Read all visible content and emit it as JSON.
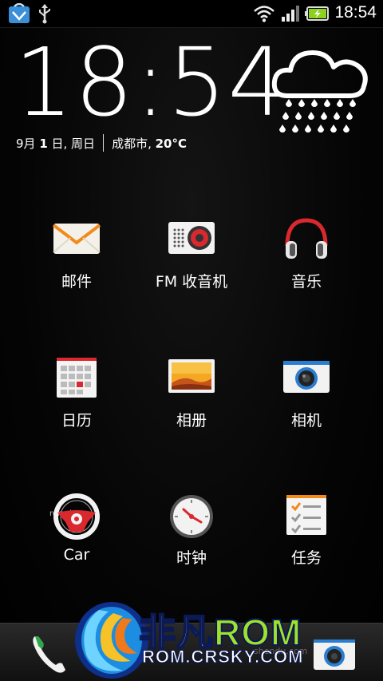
{
  "status_bar": {
    "left_icons": [
      "store-bag-icon",
      "usb-icon"
    ],
    "right_icons": [
      "wifi-icon",
      "signal-icon",
      "battery-charging-icon"
    ],
    "time": "18:54"
  },
  "clock_widget": {
    "time": "18:54",
    "date_prefix": "9月 ",
    "date_day": "1",
    "date_suffix": " 日, 周日",
    "city": "成都市, ",
    "temperature": "20°C",
    "weather_icon": "cloud-rain-icon"
  },
  "apps": [
    {
      "label": "邮件",
      "icon": "mail-icon"
    },
    {
      "label": "FM 收音机",
      "icon": "fm-radio-icon"
    },
    {
      "label": "音乐",
      "icon": "headphones-icon"
    },
    {
      "label": "日历",
      "icon": "calendar-icon"
    },
    {
      "label": "相册",
      "icon": "gallery-icon"
    },
    {
      "label": "相机",
      "icon": "camera-icon"
    },
    {
      "label": "Car",
      "icon": "steering-wheel-icon"
    },
    {
      "label": "时钟",
      "icon": "clock-icon"
    },
    {
      "label": "任务",
      "icon": "tasks-icon"
    }
  ],
  "dock": {
    "icons": [
      "phone-icon",
      "camera-icon"
    ]
  },
  "watermark": {
    "brand_cn": "非凡",
    "brand_rom": "ROM",
    "url": "ROM.CRSKY.COM",
    "small_mark": "romzj.com",
    "small_mark2": "shendu.com"
  }
}
